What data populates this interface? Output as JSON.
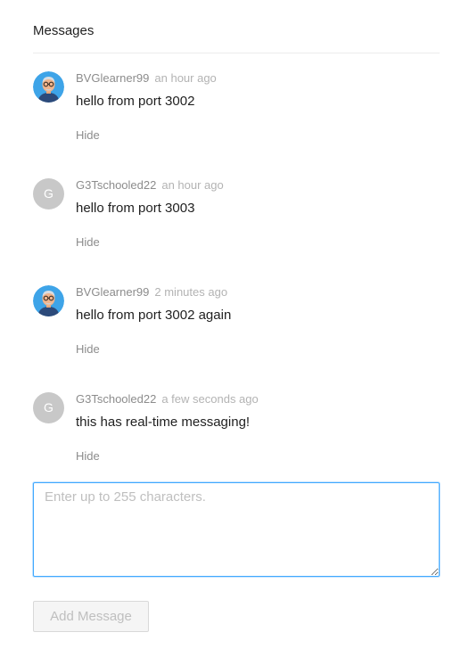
{
  "header": {
    "title": "Messages"
  },
  "comments": [
    {
      "author": "BVGlearner99",
      "time": "an hour ago",
      "content": "hello from port 3002",
      "action": "Hide",
      "avatar_type": "illustrated-person-icon"
    },
    {
      "author": "G3Tschooled22",
      "time": "an hour ago",
      "content": "hello from port 3003",
      "action": "Hide",
      "avatar_type": "letter",
      "avatar_letter": "G"
    },
    {
      "author": "BVGlearner99",
      "time": "2 minutes ago",
      "content": "hello from port 3002 again",
      "action": "Hide",
      "avatar_type": "illustrated-person-icon"
    },
    {
      "author": "G3Tschooled22",
      "time": "a few seconds ago",
      "content": "this has real-time messaging!",
      "action": "Hide",
      "avatar_type": "letter",
      "avatar_letter": "G"
    }
  ],
  "editor": {
    "placeholder": "Enter up to 255 characters.",
    "value": ""
  },
  "submit": {
    "label": "Add Message",
    "disabled": true
  },
  "colors": {
    "accent_border": "#40a9ff",
    "avatar_bg": "#c8c8c8",
    "avatar_circle": "#3ea4e8"
  }
}
